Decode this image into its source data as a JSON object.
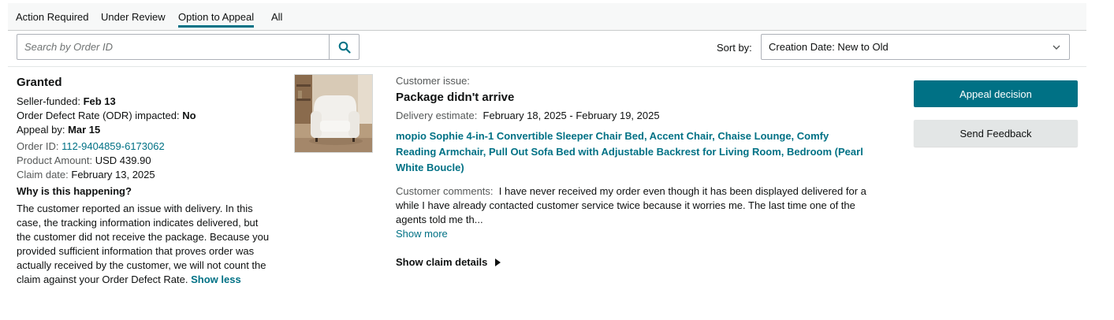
{
  "tabs": [
    {
      "label": "Action Required",
      "active": false
    },
    {
      "label": "Under Review",
      "active": false
    },
    {
      "label": "Option to Appeal",
      "active": true
    },
    {
      "label": "All",
      "active": false
    }
  ],
  "search": {
    "placeholder": "Search by Order ID",
    "value": "",
    "icon": "search-icon"
  },
  "sort": {
    "label": "Sort by:",
    "selected": "Creation Date: New to Old",
    "icon": "chevron-down-icon"
  },
  "claim": {
    "status": "Granted",
    "seller_funded_label": "Seller-funded:",
    "seller_funded_value": "Feb 13",
    "odr_label": "Order Defect Rate (ODR) impacted:",
    "odr_value": "No",
    "appeal_by_label": "Appeal by:",
    "appeal_by_value": "Mar 15",
    "order_id_label": "Order ID:",
    "order_id_value": "112-9404859-6173062",
    "amount_label": "Product Amount:",
    "amount_value": "USD 439.90",
    "claim_date_label": "Claim date:",
    "claim_date_value": "February 13, 2025",
    "why_heading": "Why is this happening?",
    "explanation": "The customer reported an issue with delivery. In this case, the tracking information indicates delivered, but the customer did not receive the package. Because you provided sufficient information that proves order was actually received by the customer, we will not count the claim against your Order Defect Rate.",
    "show_less": "Show less"
  },
  "issue": {
    "label": "Customer issue:",
    "title": "Package didn't arrive",
    "delivery_label": "Delivery estimate:",
    "delivery_value": "February 18, 2025 - February 19, 2025",
    "product_title": "mopio Sophie 4-in-1 Convertible Sleeper Chair Bed, Accent Chair, Chaise Lounge, Comfy Reading Armchair, Pull Out Sofa Bed with Adjustable Backrest for Living Room, Bedroom (Pearl White Boucle)",
    "comments_label": "Customer comments:",
    "comments_text": "I have never received my order even though it has been displayed delivered for a while I have already contacted customer service twice because it worries me. The last time one of the agents told me th...",
    "show_more": "Show more",
    "claim_details": "Show claim details"
  },
  "actions": {
    "appeal": "Appeal decision",
    "feedback": "Send Feedback"
  },
  "colors": {
    "accent": "#007185",
    "button_secondary": "#e3e6e6",
    "text": "#0f1111",
    "muted": "#565959"
  }
}
